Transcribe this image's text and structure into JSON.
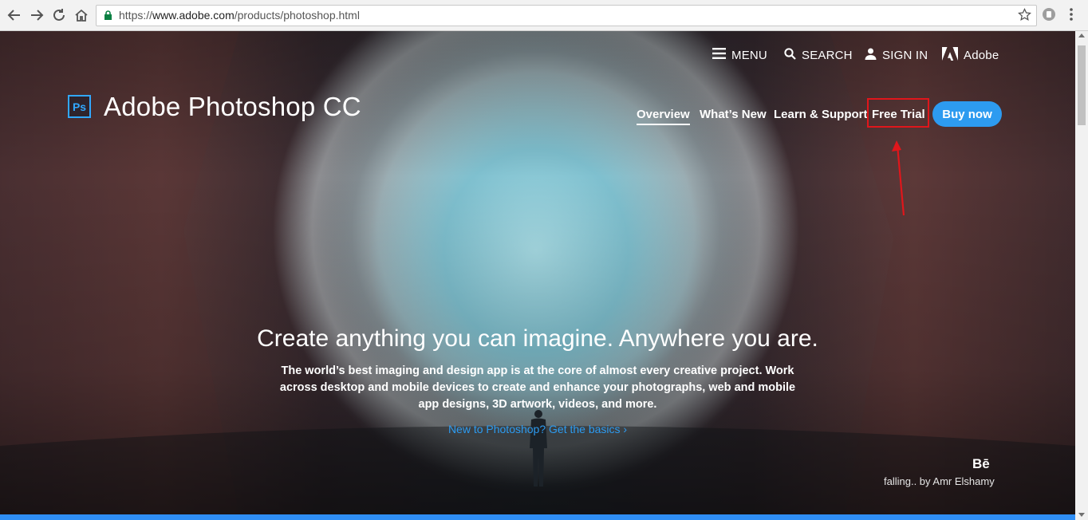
{
  "browser": {
    "url_scheme": "https://",
    "url_host": "www.adobe.com",
    "url_path": "/products/photoshop.html"
  },
  "global_nav": {
    "menu": "MENU",
    "search": "SEARCH",
    "sign_in": "SIGN IN",
    "adobe": "Adobe"
  },
  "product": {
    "logo_text": "Ps",
    "title": "Adobe Photoshop CC",
    "nav": {
      "overview": "Overview",
      "whats_new": "What’s New",
      "learn_support": "Learn & Support",
      "free_trial": "Free Trial",
      "buy_now": "Buy now"
    }
  },
  "hero": {
    "title": "Create anything you can imagine. Anywhere you are.",
    "body": "The world’s best imaging and design app is at the core of almost every creative project. Work across desktop and mobile devices to create and enhance your photographs, web and mobile app designs, 3D artwork, videos, and more.",
    "link": "New to Photoshop? Get the basics ›"
  },
  "credit": {
    "behance_logo": "Bē",
    "text": "falling.. by Amr Elshamy"
  },
  "colors": {
    "accent_blue": "#2d9bf0",
    "ps_blue": "#31a8ff",
    "annotation_red": "#e0161b"
  }
}
